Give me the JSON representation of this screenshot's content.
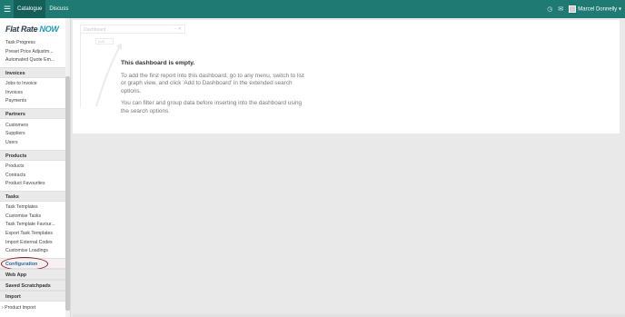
{
  "topbar": {
    "tabs": [
      "Catalogue",
      "Discuss"
    ],
    "user": "Marcel Donnelly"
  },
  "sidebar": {
    "logo_prefix": "Flat Rate ",
    "logo_suffix": "NOW",
    "top_items": [
      "Task Progress",
      "Preset Price Adjustm...",
      "Automated Quote Em..."
    ],
    "invoices": {
      "title": "Invoices",
      "items": [
        "Jobs to Invoice",
        "Invoices",
        "Payments"
      ]
    },
    "partners": {
      "title": "Partners",
      "items": [
        "Customers",
        "Suppliers",
        "Users"
      ]
    },
    "products": {
      "title": "Products",
      "items": [
        "Products",
        "Contracts",
        "Product Favourites"
      ]
    },
    "tasks": {
      "title": "Tasks",
      "items": [
        "Task Templates",
        "Customise Tasks",
        "Task Template Favour...",
        "Export Task Templates",
        "Import External Codes",
        "Customise Loadings"
      ]
    },
    "configuration": "Configuration",
    "web_app": "Web App",
    "saved_scratchpads": "Saved Scratchpads",
    "import": {
      "title": "Import",
      "items": [
        "Product Import"
      ]
    }
  },
  "dashboard": {
    "ghost_title": "Dashboard",
    "ghost_button": "Add",
    "empty_title": "This dashboard is empty.",
    "para1": "To add the first report into this dashboard, go to any menu, switch to list or graph view, and click 'Add to Dashboard' in the extended search options.",
    "para2": "You can filter and group data before inserting into the dashboard using the search options."
  }
}
